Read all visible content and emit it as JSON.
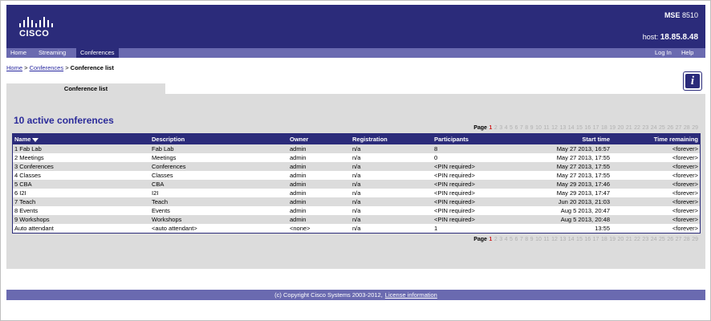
{
  "header": {
    "logo_text": "CISCO",
    "model_bold": "MSE",
    "model_num": "8510",
    "host_label": "host:",
    "host_value": "18.85.8.48"
  },
  "nav": {
    "left": [
      "Home",
      "Streaming",
      "Conferences"
    ],
    "right": [
      "Log In",
      "Help"
    ],
    "active": "Conferences"
  },
  "breadcrumb": {
    "home": "Home",
    "sep1": " > ",
    "conferences": "Conferences",
    "sep2": " > ",
    "current": "Conference list"
  },
  "tab": {
    "label": "Conference list"
  },
  "info_icon": {
    "glyph": "i"
  },
  "heading": "10 active conferences",
  "pager": {
    "label": "Page",
    "current": "1",
    "pages": [
      "1",
      "2",
      "3",
      "4",
      "5",
      "6",
      "7",
      "8",
      "9",
      "10",
      "11",
      "12",
      "13",
      "14",
      "15",
      "16",
      "17",
      "18",
      "19",
      "20",
      "21",
      "22",
      "23",
      "24",
      "25",
      "26",
      "27",
      "28",
      "29"
    ]
  },
  "table": {
    "columns": {
      "name": "Name",
      "description": "Description",
      "owner": "Owner",
      "registration": "Registration",
      "participants": "Participants",
      "start_time": "Start time",
      "time_remaining": "Time remaining"
    },
    "rows": [
      {
        "name": "1 Fab Lab",
        "description": "Fab Lab",
        "owner": "admin",
        "registration": "n/a",
        "participants": "8",
        "start": "May 27 2013, 16:57",
        "remaining": "<forever>"
      },
      {
        "name": "2 Meetings",
        "description": "Meetings",
        "owner": "admin",
        "registration": "n/a",
        "participants": "0",
        "start": "May 27 2013, 17:55",
        "remaining": "<forever>"
      },
      {
        "name": "3 Conferences",
        "description": "Conferences",
        "owner": "admin",
        "registration": "n/a",
        "participants": "<PIN required>",
        "start": "May 27 2013, 17:55",
        "remaining": "<forever>"
      },
      {
        "name": "4 Classes",
        "description": "Classes",
        "owner": "admin",
        "registration": "n/a",
        "participants": "<PIN required>",
        "start": "May 27 2013, 17:55",
        "remaining": "<forever>"
      },
      {
        "name": "5 CBA",
        "description": "CBA",
        "owner": "admin",
        "registration": "n/a",
        "participants": "<PIN required>",
        "start": "May 29 2013, 17:46",
        "remaining": "<forever>"
      },
      {
        "name": "6 I2I",
        "description": "I2I",
        "owner": "admin",
        "registration": "n/a",
        "participants": "<PIN required>",
        "start": "May 29 2013, 17:47",
        "remaining": "<forever>"
      },
      {
        "name": "7 Teach",
        "description": "Teach",
        "owner": "admin",
        "registration": "n/a",
        "participants": "<PIN required>",
        "start": "Jun 20 2013, 21:03",
        "remaining": "<forever>"
      },
      {
        "name": "8 Events",
        "description": "Events",
        "owner": "admin",
        "registration": "n/a",
        "participants": "<PIN required>",
        "start": "Aug 5 2013, 20:47",
        "remaining": "<forever>"
      },
      {
        "name": "9 Workshops",
        "description": "Workshops",
        "owner": "admin",
        "registration": "n/a",
        "participants": "<PIN required>",
        "start": "Aug 5 2013, 20:48",
        "remaining": "<forever>"
      },
      {
        "name": "Auto attendant",
        "description": "<auto attendant>",
        "owner": "<none>",
        "registration": "n/a",
        "participants": "1",
        "start": "13:55",
        "remaining": "<forever>"
      }
    ]
  },
  "footer": {
    "copyright": "(c) Copyright Cisco Systems 2003-2012,",
    "license_link": "License information"
  },
  "colors": {
    "header_bg": "#2b2b7a",
    "nav_bg": "#6a6ab0",
    "heading": "#2b2b9a",
    "current_page": "#d02020",
    "panel_bg": "#dcdcdc"
  }
}
